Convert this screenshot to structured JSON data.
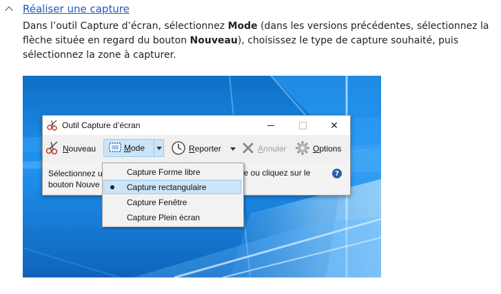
{
  "section": {
    "title": "Réaliser une capture",
    "desc_1": "Dans l’outil Capture d’écran, sélectionnez ",
    "desc_mode": "Mode",
    "desc_2": " (dans les versions précédentes, sélectionnez la flèche située en regard du bouton ",
    "desc_new": "Nouveau",
    "desc_3": "), choisissez le type de capture souhaité, puis sélectionnez la zone à capturer."
  },
  "window": {
    "title": "Outil Capture d’écran",
    "close_glyph": "✕"
  },
  "toolbar": {
    "new_u": "N",
    "new_rest": "ouveau",
    "mode_u": "M",
    "mode_rest": "ode",
    "delay_u": "R",
    "delay_rest": "eporter",
    "cancel_u": "A",
    "cancel_rest": "nnuler",
    "options_u": "O",
    "options_rest": "ptions"
  },
  "info": {
    "line1_left": "Sélectionnez un",
    "line2_left": "bouton Nouve",
    "line1_right": "de ou cliquez sur le",
    "help": "?"
  },
  "menu": {
    "items": [
      {
        "label": "Capture Forme libre",
        "selected": false
      },
      {
        "label": "Capture rectangulaire",
        "selected": true
      },
      {
        "label": "Capture Fenêtre",
        "selected": false
      },
      {
        "label": "Capture Plein écran",
        "selected": false
      }
    ]
  },
  "colors": {
    "link": "#1a5bb5",
    "desktop_blue": "#1f8ef0",
    "selection": "#cce4f7"
  }
}
